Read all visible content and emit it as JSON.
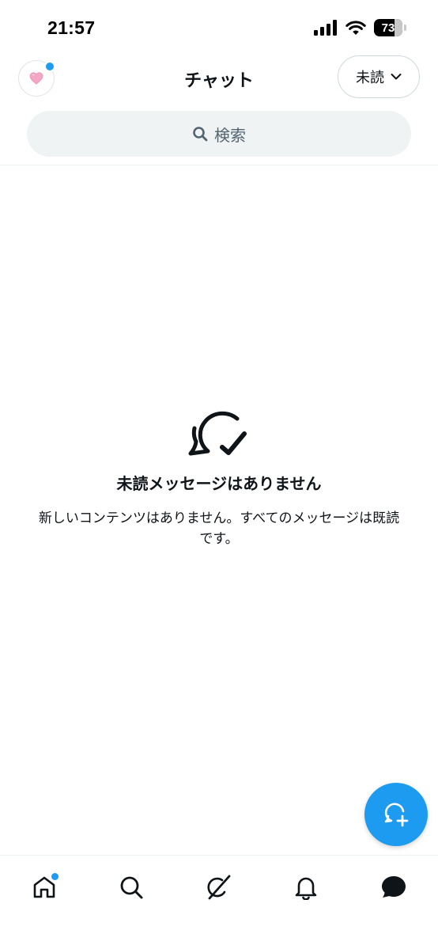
{
  "status_bar": {
    "time": "21:57",
    "battery_level": "73",
    "battery_fraction": 0.73,
    "icons": [
      "cellular-signal-icon",
      "wifi-icon",
      "battery-icon"
    ]
  },
  "header": {
    "title": "チャット",
    "filter_label": "未読",
    "avatar_icon": "heart-icon",
    "avatar_has_notification": true
  },
  "search": {
    "placeholder": "検索",
    "icon": "search-icon"
  },
  "empty_state": {
    "icon": "chat-check-icon",
    "title": "未読メッセージはありません",
    "description": "新しいコンテンツはありません。すべてのメッセージは既読です。"
  },
  "fab": {
    "icon": "new-chat-icon"
  },
  "bottom_nav": {
    "items": [
      {
        "name": "home",
        "icon": "home-icon",
        "has_notification": true
      },
      {
        "name": "search",
        "icon": "search-icon",
        "has_notification": false
      },
      {
        "name": "grok",
        "icon": "grok-icon",
        "has_notification": false
      },
      {
        "name": "notifications",
        "icon": "bell-icon",
        "has_notification": false
      },
      {
        "name": "chat",
        "icon": "chat-bubble-icon",
        "has_notification": false,
        "active": true
      }
    ]
  },
  "colors": {
    "accent": "#1d9bf0",
    "text_primary": "#0f1419",
    "text_secondary": "#536471",
    "search_bg": "#eff3f4",
    "heart": "#f4a6c4"
  }
}
